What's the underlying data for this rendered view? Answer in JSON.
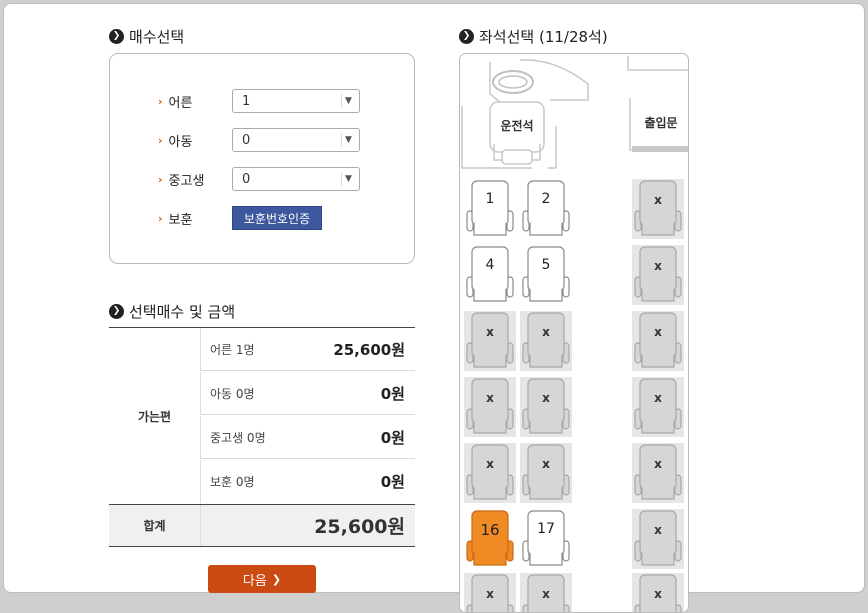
{
  "qty_section": {
    "title": "매수선택",
    "rows": [
      {
        "label": "어른",
        "value": "1"
      },
      {
        "label": "아동",
        "value": "0"
      },
      {
        "label": "중고생",
        "value": "0"
      }
    ],
    "veteran": {
      "label": "보훈",
      "button": "보훈번호인증"
    }
  },
  "summary_section": {
    "title": "선택매수 및 금액",
    "direction": "가는편",
    "rows": [
      {
        "label": "어른 1명",
        "amount": "25,600원"
      },
      {
        "label": "아동 0명",
        "amount": "0원"
      },
      {
        "label": "중고생 0명",
        "amount": "0원"
      },
      {
        "label": "보훈 0명",
        "amount": "0원"
      }
    ],
    "total_label": "합계",
    "total_amount": "25,600원"
  },
  "next_button": "다음",
  "seat_section": {
    "title": "좌석선택 (11/28석)",
    "driver_label": "운전석",
    "door_label": "출입문",
    "colors": {
      "selected": "#f08a24",
      "available": "#ffffff",
      "taken": "#d6d6d6"
    },
    "seats": [
      {
        "label": "1",
        "state": "available"
      },
      {
        "label": "2",
        "state": "available"
      },
      {
        "label": "X",
        "state": "taken"
      },
      {
        "label": "4",
        "state": "available"
      },
      {
        "label": "5",
        "state": "available"
      },
      {
        "label": "X",
        "state": "taken"
      },
      {
        "label": "X",
        "state": "taken"
      },
      {
        "label": "X",
        "state": "taken"
      },
      {
        "label": "X",
        "state": "taken"
      },
      {
        "label": "X",
        "state": "taken"
      },
      {
        "label": "X",
        "state": "taken"
      },
      {
        "label": "X",
        "state": "taken"
      },
      {
        "label": "X",
        "state": "taken"
      },
      {
        "label": "X",
        "state": "taken"
      },
      {
        "label": "X",
        "state": "taken"
      },
      {
        "label": "16",
        "state": "selected"
      },
      {
        "label": "17",
        "state": "available"
      },
      {
        "label": "X",
        "state": "taken"
      },
      {
        "label": "X",
        "state": "taken"
      },
      {
        "label": "X",
        "state": "taken"
      },
      {
        "label": "X",
        "state": "taken"
      }
    ]
  }
}
